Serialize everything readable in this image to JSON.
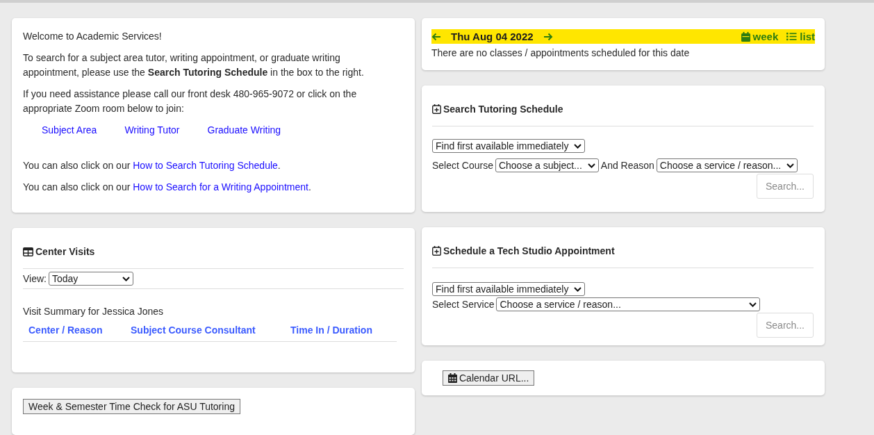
{
  "welcome": {
    "greeting": "Welcome to Academic Services!",
    "paragraphs": [
      "To search for a subject area tutor, writing appointment, or graduate writing appointment, please use the **Search Tutoring Schedule** in the box to the right.",
      "If you need assistance please call our front desk 480-965-9072 or click on the appropriate Zoom room below to join:"
    ],
    "zoom_links": [
      "Subject Area",
      "Writing Tutor",
      "Graduate Writing"
    ],
    "help_lines": [
      {
        "text": "You can also click on our ",
        "link": "How to Search Tutoring Schedule",
        "after": "."
      },
      {
        "text": "You can also click on our ",
        "link": "How to Search for a Writing Appointment",
        "after": "."
      }
    ]
  },
  "center_visits": {
    "title": "Center Visits",
    "view_label": "View:",
    "view_value": "Today",
    "summary": "Visit Summary for Jessica Jones",
    "columns": [
      "Center / Reason",
      "Subject Course Consultant",
      "Time In / Duration"
    ]
  },
  "time_check_button": "Week & Semester Time Check for ASU Tutoring",
  "date_nav": {
    "date": "Thu Aug 04 2022",
    "highlighted": true,
    "views": [
      {
        "kind": "calendar",
        "label": "week"
      },
      {
        "kind": "list",
        "label": "list"
      }
    ],
    "message": "There are no classes / appointments scheduled for this date"
  },
  "search_tutoring": {
    "title": "Search Tutoring Schedule",
    "mode": "Find first available immediately",
    "fields": [
      {
        "label": "Select Course",
        "value": "Choose a subject..."
      },
      {
        "label": "And Reason",
        "value": "Choose a service / reason..."
      }
    ],
    "button": {
      "label": "Search...",
      "disabled": true
    }
  },
  "tech_studio": {
    "title": "Schedule a Tech Studio Appointment",
    "mode": "Find first available immediately",
    "fields": [
      {
        "label": "Select Service",
        "value": "Choose a service / reason..."
      }
    ],
    "button": {
      "label": "Search...",
      "disabled": true
    }
  },
  "calendar_button": "Calendar URL..."
}
